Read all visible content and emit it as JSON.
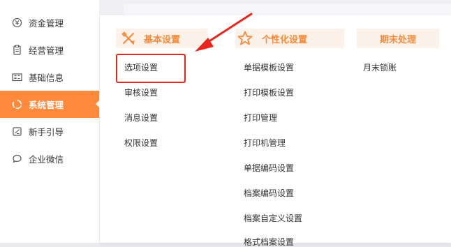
{
  "sidebar": {
    "items": [
      {
        "label": "资金管理",
        "icon": "money-icon",
        "active": false
      },
      {
        "label": "经营管理",
        "icon": "clipboard-icon",
        "active": false
      },
      {
        "label": "基础信息",
        "icon": "id-card-icon",
        "active": false
      },
      {
        "label": "系统管理",
        "icon": "system-icon",
        "active": true
      },
      {
        "label": "新手引导",
        "icon": "guide-icon",
        "active": false
      },
      {
        "label": "企业微信",
        "icon": "chat-icon",
        "active": false
      }
    ]
  },
  "panel": {
    "columns": [
      {
        "title": "基本设置",
        "icon": "wrench-pencil-icon",
        "items": [
          "选项设置",
          "审核设置",
          "消息设置",
          "权限设置"
        ]
      },
      {
        "title": "个性化设置",
        "icon": "star-icon",
        "items": [
          "单据模板设置",
          "打印模板设置",
          "打印管理",
          "打印机管理",
          "单据编码设置",
          "档案编码设置",
          "档案自定义设置",
          "格式档案设置"
        ]
      },
      {
        "title": "期末处理",
        "icon": "",
        "items": [
          "月末锁账"
        ]
      }
    ],
    "highlighted_item": "选项设置"
  },
  "colors": {
    "accent": "#ff8a3d",
    "header_bg": "#fdf2ea",
    "header_text": "#f58a3a",
    "annotation_red": "#e8261d"
  }
}
